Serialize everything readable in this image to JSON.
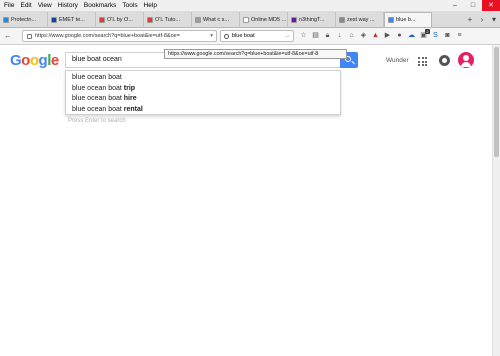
{
  "menu": [
    "File",
    "Edit",
    "View",
    "History",
    "Bookmarks",
    "Tools",
    "Help"
  ],
  "tabs": [
    {
      "label": "Protectn...",
      "color": "#1e88e5"
    },
    {
      "label": "EMET te...",
      "color": "#0d47a1"
    },
    {
      "label": "O'L by O...",
      "color": "#e53935"
    },
    {
      "label": "O'L Tuto...",
      "color": "#e53935"
    },
    {
      "label": "What c s...",
      "color": "#9e9e9e"
    },
    {
      "label": "Online MD5 ...",
      "color": "#ffffff"
    },
    {
      "label": "n3thingT...",
      "color": "#6a1b9a"
    },
    {
      "label": "zest way ...",
      "color": "#888888"
    },
    {
      "label": "blue b...",
      "color": "#4285f4"
    }
  ],
  "nav": {
    "url": "https://www.google.com/search?q=blue+boat&ie=utf-8&oe=",
    "search_value": "blue boat"
  },
  "tooltip": "https://www.google.com/search?q=blue+boat&ie=utf-8&oe=utf-8",
  "google": {
    "logo": [
      "G",
      "o",
      "o",
      "g",
      "l",
      "e"
    ],
    "query": "blue boat ocean",
    "suggestions": [
      {
        "base": "blue ocean boat",
        "bold": ""
      },
      {
        "base": "blue ocean boat ",
        "bold": "trip"
      },
      {
        "base": "blue ocean boat ",
        "bold": "hire"
      },
      {
        "base": "blue ocean boat ",
        "bold": "rental"
      }
    ],
    "hint": "Press Enter to search",
    "user": "Wunder"
  },
  "colors": {
    "accent": "#4285f4",
    "avatar": "#e91e63"
  }
}
